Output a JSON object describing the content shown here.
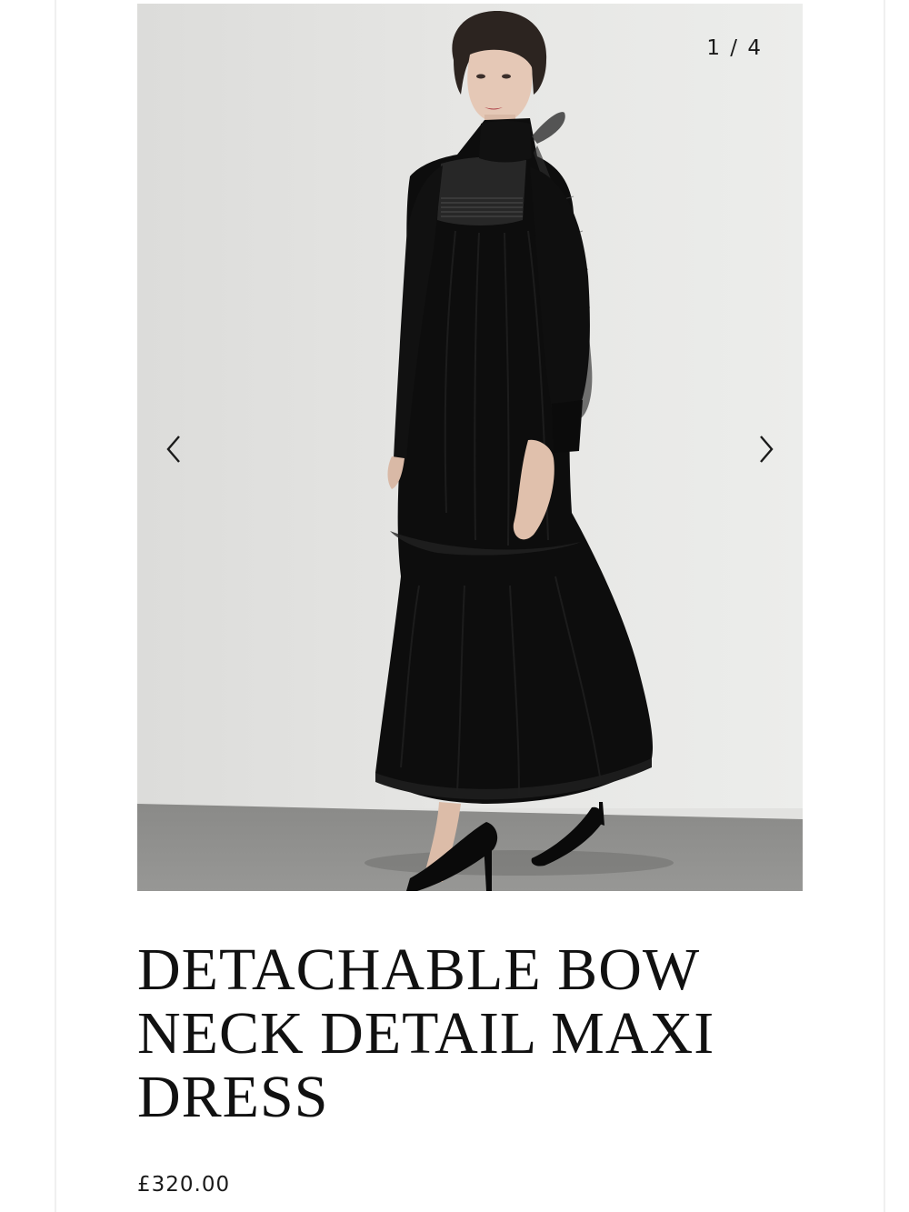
{
  "gallery": {
    "counter": "1 / 4",
    "image_alt": "Model wearing black detachable bow neck maxi dress",
    "prev_icon": "chevron-left-icon",
    "next_icon": "chevron-right-icon"
  },
  "product": {
    "title": "DETACHABLE BOW NECK DETAIL MAXI DRESS",
    "price": "£320.00"
  },
  "colors": {
    "backdrop": "#e2e2e0",
    "floor": "#8e8e8c",
    "dress": "#0d0d0d",
    "text": "#111111"
  }
}
